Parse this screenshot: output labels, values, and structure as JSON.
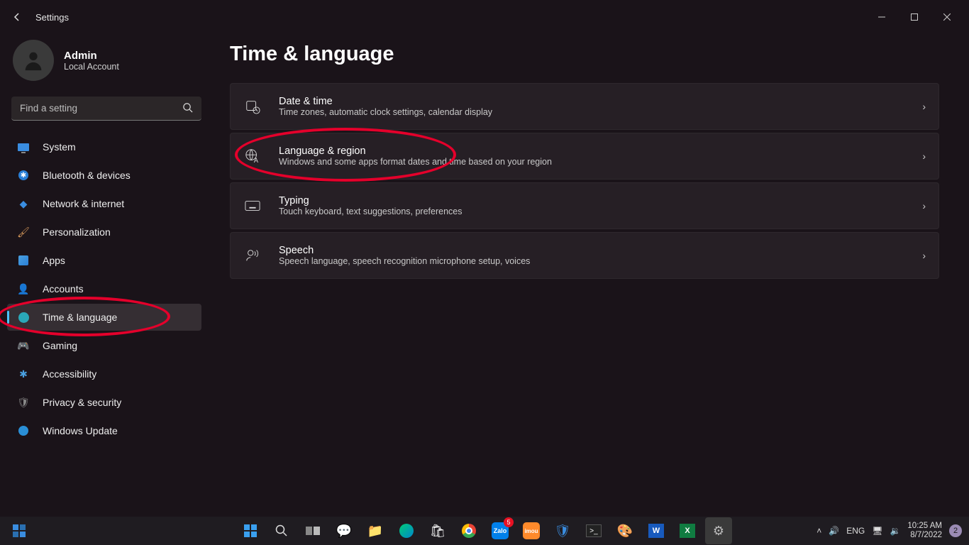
{
  "window": {
    "title": "Settings"
  },
  "user": {
    "name": "Admin",
    "sub": "Local Account"
  },
  "search": {
    "placeholder": "Find a setting"
  },
  "nav": {
    "system": "System",
    "bluetooth": "Bluetooth & devices",
    "network": "Network & internet",
    "personalization": "Personalization",
    "apps": "Apps",
    "accounts": "Accounts",
    "time": "Time & language",
    "gaming": "Gaming",
    "accessibility": "Accessibility",
    "privacy": "Privacy & security",
    "update": "Windows Update"
  },
  "page": {
    "title": "Time & language"
  },
  "cards": {
    "datetime": {
      "title": "Date & time",
      "sub": "Time zones, automatic clock settings, calendar display"
    },
    "language": {
      "title": "Language & region",
      "sub": "Windows and some apps format dates and time based on your region"
    },
    "typing": {
      "title": "Typing",
      "sub": "Touch keyboard, text suggestions, preferences"
    },
    "speech": {
      "title": "Speech",
      "sub": "Speech language, speech recognition microphone setup, voices"
    }
  },
  "tray": {
    "lang": "ENG",
    "time": "10:25 AM",
    "date": "8/7/2022",
    "notif": "2"
  },
  "taskbar_badge": "5",
  "annotations": {
    "highlight_sidebar": "Time & language",
    "highlight_card": "Language & region"
  }
}
